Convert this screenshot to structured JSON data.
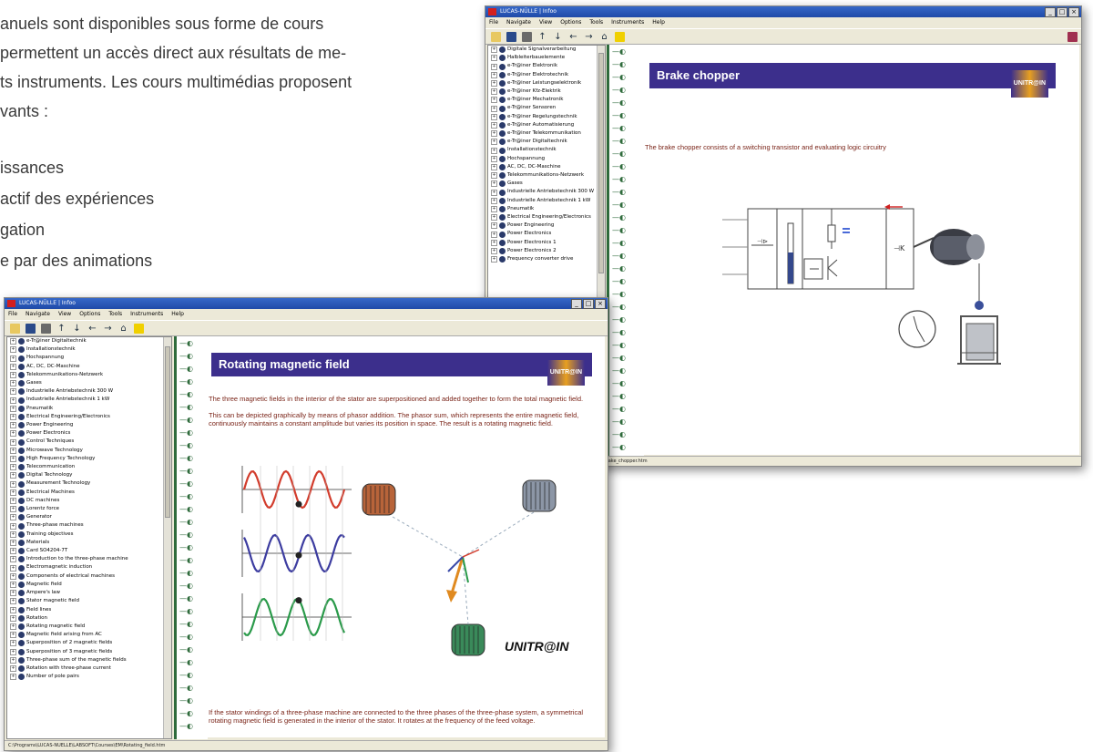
{
  "background_text": {
    "lines": [
      "anuels sont disponibles sous forme de cours",
      "permettent un accès direct aux résultats de me-",
      "ts instruments. Les cours multimédias proposent",
      "vants :"
    ],
    "bullets": [
      "issances",
      "actif des expériences",
      "gation",
      "e par des animations"
    ]
  },
  "window_back": {
    "title": "LUCAS-NÜLLE | Infoo",
    "menu": [
      "File",
      "Navigate",
      "View",
      "Options",
      "Tools",
      "Instruments",
      "Help"
    ],
    "tree_items": [
      "Digitale Signalverarbeitung",
      "Halbleiterbauelemente",
      "e-Tr@iner Elektronik",
      "e-Tr@iner Elektrotechnik",
      "e-Tr@iner Leistungselektronik",
      "e-Tr@iner Kfz-Elektrik",
      "e-Tr@iner Mechatronik",
      "e-Tr@iner Sensoren",
      "e-Tr@iner Regelungstechnik",
      "e-Tr@iner Automatisierung",
      "e-Tr@iner Telekommunikation",
      "e-Tr@iner Digitaltechnik",
      "Installationstechnik",
      "Hochspannung",
      "AC, DC, DC-Maschine",
      "Telekommunikations-Netzwerk",
      "Gases",
      "Industrielle Antriebstechnik 300 W",
      "Industrielle Antriebstechnik 1 kW",
      "Pneumatik",
      "Electrical Engineering/Electronics",
      "Power Engineering",
      "Power Electronics",
      "Power Electronics 1",
      "Power Electronics 2",
      "Frequency converter drive"
    ],
    "page_title": "Brake chopper",
    "logo": "UNITR@IN",
    "description": "The brake chopper consists of a switching transistor and evaluating logic circuitry",
    "status": "C:\\Programs\\LUCAS-NUELLE\\LABSOFT\\Courses\\PE\\Brake_chopper.htm"
  },
  "window_front": {
    "title": "LUCAS-NÜLLE | Infoo",
    "menu": [
      "File",
      "Navigate",
      "View",
      "Options",
      "Tools",
      "Instruments",
      "Help"
    ],
    "tree_items": [
      "e-Tr@iner Digitaltechnik",
      "Installationstechnik",
      "Hochspannung",
      "AC, DC, DC-Maschine",
      "Telekommunikations-Netzwerk",
      "Gases",
      "Industrielle Antriebstechnik 300 W",
      "Industrielle Antriebstechnik 1 kW",
      "Pneumatik",
      "Electrical Engineering/Electronics",
      "Power Engineering",
      "Power Electronics",
      "Control Techniques",
      "Microwave Technology",
      "High Frequency Technology",
      "Telecommunication",
      "Digital Technology",
      "Measurement Technology",
      "Electrical Machines",
      "DC machines",
      "Lorentz force",
      "Generator",
      "Three-phase machines",
      "Training objectives",
      "Materials",
      "Card SO4204-7T",
      "Introduction to the three-phase machine",
      "Electromagnetic induction",
      "Components of electrical machines",
      "Magnetic field",
      "Ampere's law",
      "Stator magnetic field",
      "Field lines",
      "Rotation",
      "Rotating magnetic field",
      "Magnetic field arising from AC",
      "Superposition of 2 magnetic fields",
      "Superposition of 3 magnetic fields",
      "Three-phase sum of the magnetic fields",
      "Rotation with three-phase current",
      "Number of pole pairs"
    ],
    "page_title": "Rotating magnetic field",
    "logo": "UNITR@IN",
    "paragraph1": "The three magnetic fields in the interior of the stator are superpositioned and added together to form the total magnetic field.",
    "paragraph2": "This can be depicted graphically by means of phasor addition. The phasor sum, which represents the entire magnetic field, continuously maintains a constant amplitude but varies its position in space. The result is a rotating magnetic field.",
    "paragraph3": "If the stator windings of a three-phase machine are connected to the three phases of the three-phase system, a symmetrical rotating magnetic field is generated in the interior of the stator. It rotates at the frequency of the feed voltage.",
    "brand": "UNITR@IN",
    "status": "C:\\Programs\\LUCAS-NUELLE\\LABSOFT\\Courses\\EM\\Rotating_field.htm",
    "wave_colors": [
      "#d23c2c",
      "#3c3ca0",
      "#2a9a4a"
    ]
  }
}
